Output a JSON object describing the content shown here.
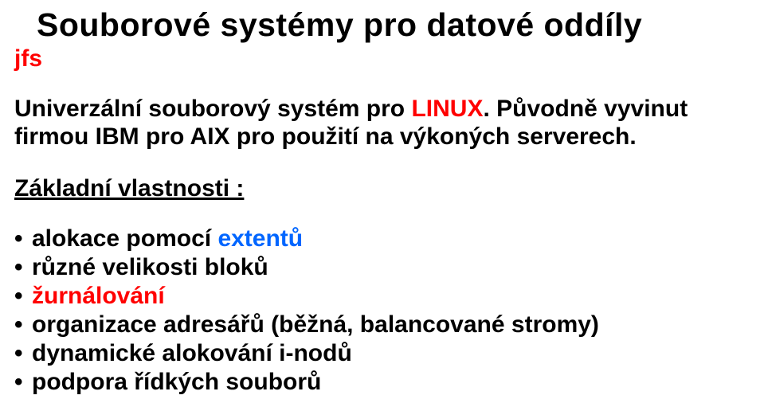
{
  "title": "Souborové systémy pro datové oddíly",
  "subtitle": "jfs",
  "paragraph": {
    "part1": "Univerzální souborový systém pro ",
    "linux": "LINUX",
    "part2": ". Původně vyvinut firmou IBM pro AIX pro použití na výkoných serverech."
  },
  "section_header": "Základní vlastnosti :",
  "bullets": [
    {
      "pre": "alokace pomocí ",
      "colored": "extentů",
      "colorClass": "blue",
      "post": ""
    },
    {
      "pre": "různé velikosti bloků",
      "colored": "",
      "colorClass": "",
      "post": ""
    },
    {
      "pre": "",
      "colored": "žurnálování",
      "colorClass": "red",
      "post": ""
    },
    {
      "pre": "organizace adresářů (běžná, balancované stromy)",
      "colored": "",
      "colorClass": "",
      "post": ""
    },
    {
      "pre": "dynamické alokování i-nodů",
      "colored": "",
      "colorClass": "",
      "post": ""
    },
    {
      "pre": "podpora řídkých souborů",
      "colored": "",
      "colorClass": "",
      "post": ""
    }
  ]
}
